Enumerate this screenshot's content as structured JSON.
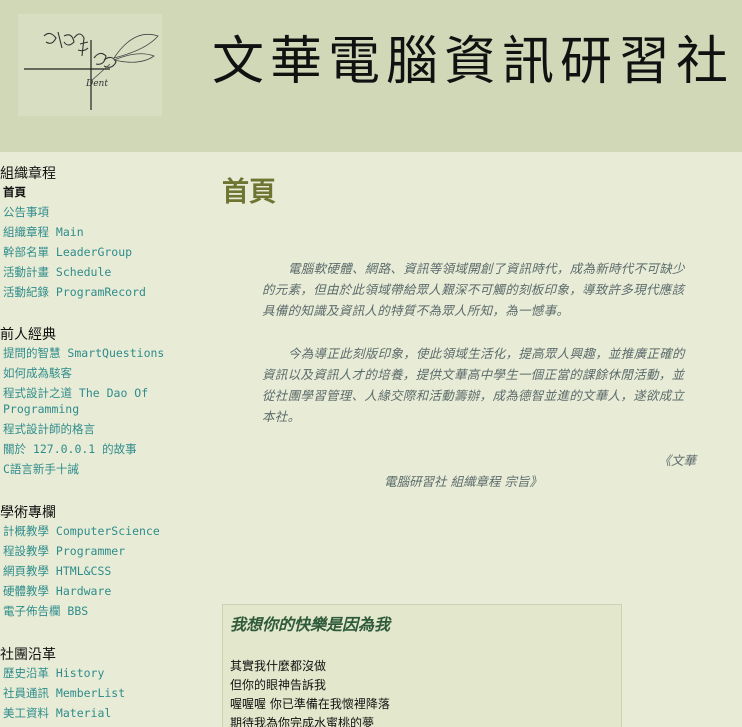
{
  "header": {
    "site_title": "文華電腦資訊研習社"
  },
  "sidebar": {
    "groups": [
      {
        "heading": "組織章程",
        "items": [
          {
            "label": "首頁",
            "active": true
          },
          {
            "label": "公告事項"
          },
          {
            "label": "組織章程 Main"
          },
          {
            "label": "幹部名單 LeaderGroup"
          },
          {
            "label": "活動計畫 Schedule"
          },
          {
            "label": "活動紀錄 ProgramRecord"
          }
        ]
      },
      {
        "heading": "前人經典",
        "items": [
          {
            "label": "提問的智慧 SmartQuestions"
          },
          {
            "label": "如何成為駭客"
          },
          {
            "label": "程式設計之道 The Dao Of Programming"
          },
          {
            "label": "程式設計師的格言"
          },
          {
            "label": "關於 127.0.0.1 的故事"
          },
          {
            "label": "C語言新手十誡"
          }
        ]
      },
      {
        "heading": "學術專欄",
        "items": [
          {
            "label": "計概教學 ComputerScience"
          },
          {
            "label": "程設教學 Programmer"
          },
          {
            "label": "網頁教學 HTML&CSS"
          },
          {
            "label": "硬體教學 Hardware"
          },
          {
            "label": "電子佈告欄 BBS"
          }
        ]
      },
      {
        "heading": "社團沿革",
        "items": [
          {
            "label": "歷史沿革 History"
          },
          {
            "label": "社員通訊 MemberList"
          },
          {
            "label": "美工資料 Material"
          }
        ]
      }
    ]
  },
  "main": {
    "page_title": "首頁",
    "intro_1": "電腦軟硬體、網路、資訊等領域開創了資訊時代，成為新時代不可缺少的元素，但由於此領域帶給眾人艱深不可觸的刻板印象，導致許多現代應該具備的知識及資訊人的特質不為眾人所知，為一憾事。",
    "intro_2": "今為導正此刻版印象，使此領域生活化，提高眾人興趣，並推廣正確的資訊以及資訊人才的培養，提供文華高中學生一個正當的課餘休閒活動，並從社團學習管理、人緣交際和活動籌辦，成為德智並進的文華人，遂欲成立本社。",
    "quote_line1": "《文華",
    "quote_line2": "電腦研習社 組織章程 宗旨》"
  },
  "lyrics": {
    "title": "我想你的快樂是因為我",
    "lines": [
      "其實我什麼都沒做",
      "但你的眼神告訴我",
      "喔喔喔 你已準備在我懷裡降落",
      "期待我為你完成水蜜桃的夢"
    ]
  },
  "colors": {
    "banner_bg": "#d0d8b8",
    "page_bg": "#e8ecd6",
    "link": "#2f8c8c",
    "title": "#6e7431",
    "body_text": "#5c6b6c"
  }
}
